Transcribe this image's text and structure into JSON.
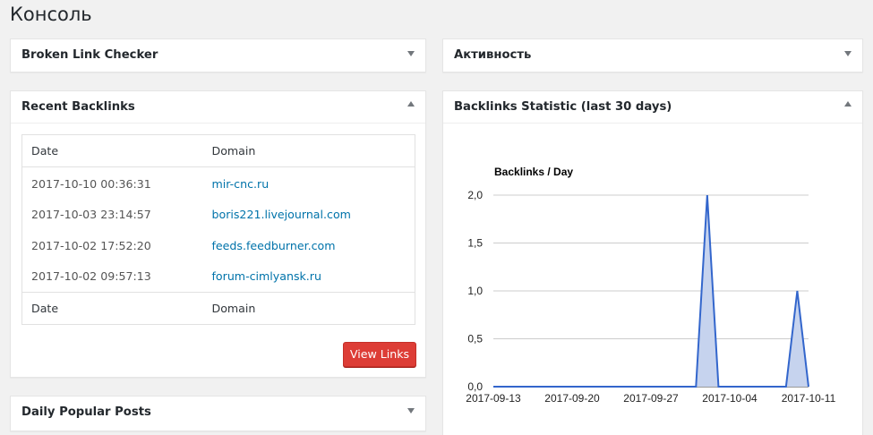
{
  "page": {
    "title": "Консоль"
  },
  "widgets": {
    "broken_link_checker": {
      "title": "Broken Link Checker"
    },
    "activity": {
      "title": "Активность"
    },
    "recent_backlinks": {
      "title": "Recent Backlinks",
      "columns": [
        "Date",
        "Domain"
      ],
      "rows": [
        {
          "date": "2017-10-10 00:36:31",
          "domain": "mir-cnc.ru"
        },
        {
          "date": "2017-10-03 23:14:57",
          "domain": "boris221.livejournal.com"
        },
        {
          "date": "2017-10-02 17:52:20",
          "domain": "feeds.feedburner.com"
        },
        {
          "date": "2017-10-02 09:57:13",
          "domain": "forum-cimlyansk.ru"
        }
      ],
      "footer_columns": [
        "Date",
        "Domain"
      ],
      "button_label": "View Links"
    },
    "daily_popular_posts": {
      "title": "Daily Popular Posts"
    },
    "backlinks_statistic": {
      "title": "Backlinks Statistic (last 30 days)"
    }
  },
  "chart_data": {
    "type": "area",
    "title": "Backlinks / Day",
    "x": [
      "2017-09-13",
      "2017-09-14",
      "2017-09-15",
      "2017-09-16",
      "2017-09-17",
      "2017-09-18",
      "2017-09-19",
      "2017-09-20",
      "2017-09-21",
      "2017-09-22",
      "2017-09-23",
      "2017-09-24",
      "2017-09-25",
      "2017-09-26",
      "2017-09-27",
      "2017-09-28",
      "2017-09-29",
      "2017-09-30",
      "2017-10-01",
      "2017-10-02",
      "2017-10-03",
      "2017-10-04",
      "2017-10-05",
      "2017-10-06",
      "2017-10-07",
      "2017-10-08",
      "2017-10-09",
      "2017-10-10",
      "2017-10-11"
    ],
    "values": [
      0,
      0,
      0,
      0,
      0,
      0,
      0,
      0,
      0,
      0,
      0,
      0,
      0,
      0,
      0,
      0,
      0,
      0,
      0,
      2,
      0,
      0,
      0,
      0,
      0,
      0,
      0,
      1,
      0
    ],
    "xticks": [
      "2017-09-13",
      "2017-09-20",
      "2017-09-27",
      "2017-10-04",
      "2017-10-11"
    ],
    "yticks": [
      "0,0",
      "0,5",
      "1,0",
      "1,5",
      "2,0"
    ],
    "ylim": [
      0,
      2
    ],
    "grid": true,
    "colors": {
      "line": "#3366cc",
      "fill": "#c6d3ee",
      "grid": "#cccccc"
    }
  }
}
